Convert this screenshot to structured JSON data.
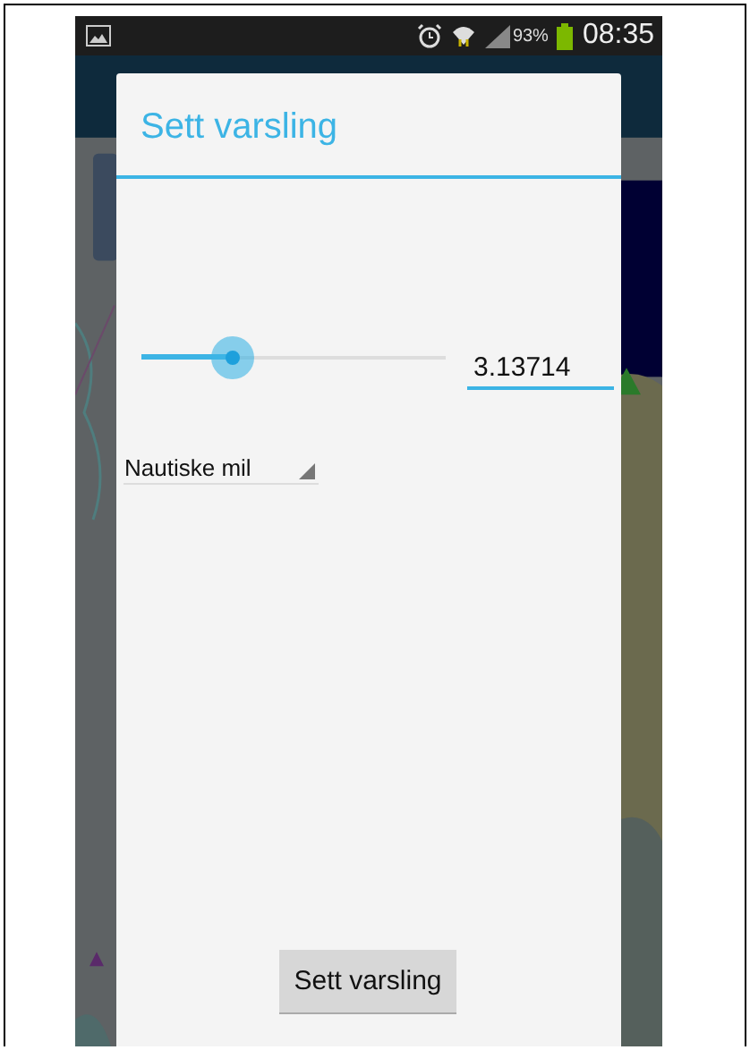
{
  "status_bar": {
    "battery_percent": "93%",
    "time": "08:35"
  },
  "dialog": {
    "title": "Sett varsling",
    "slider": {
      "level": 0.3
    },
    "value_field": {
      "value": "3.13714"
    },
    "unit_dropdown": {
      "value": "Nautiske mil"
    },
    "button": "Sett varsling"
  }
}
